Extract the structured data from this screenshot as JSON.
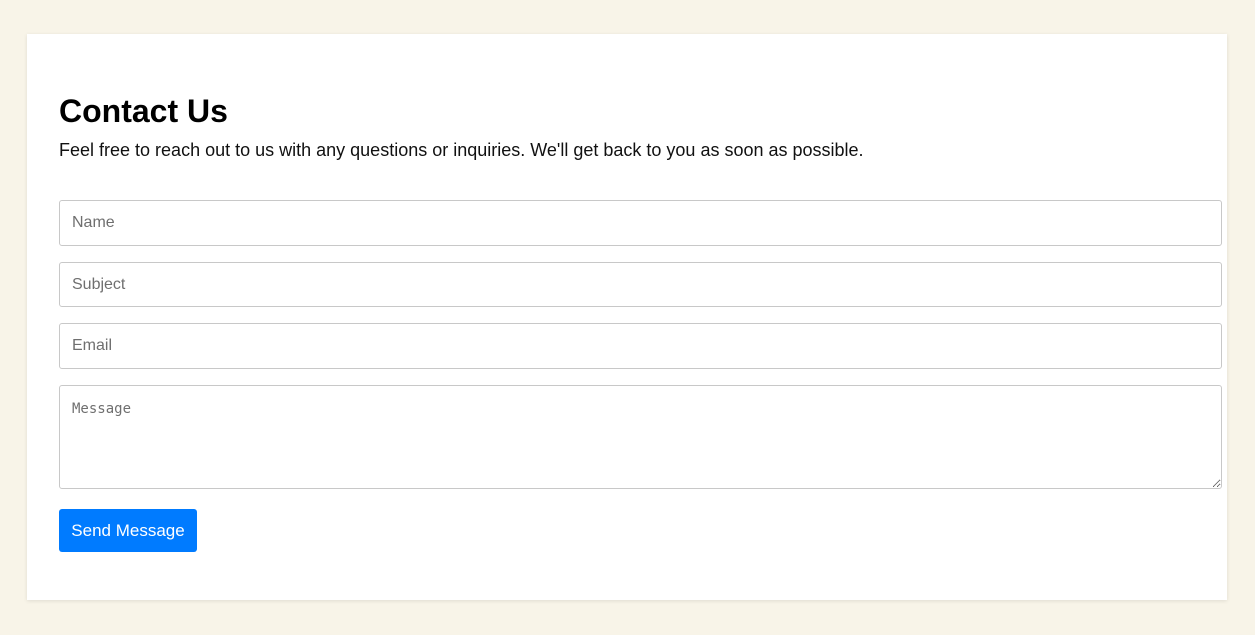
{
  "contact": {
    "title": "Contact Us",
    "intro": "Feel free to reach out to us with any questions or inquiries. We'll get back to you as soon as possible.",
    "name_placeholder": "Name",
    "subject_placeholder": "Subject",
    "email_placeholder": "Email",
    "message_placeholder": "Message",
    "submit_label": "Send Message"
  },
  "colors": {
    "page_background": "#f8f4e8",
    "card_background": "#ffffff",
    "button_background": "#007bff",
    "button_text": "#ffffff"
  }
}
